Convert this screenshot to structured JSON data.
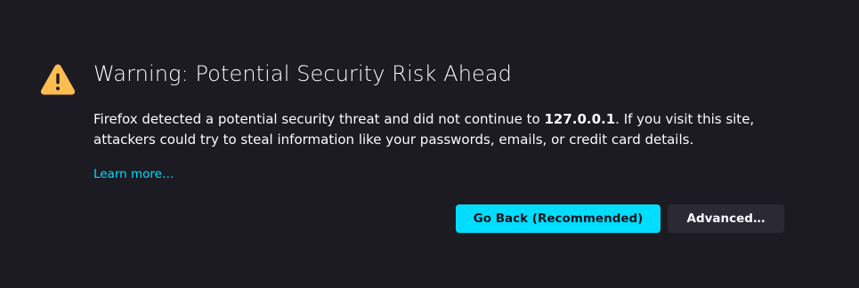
{
  "error_page": {
    "title": "Warning: Potential Security Risk Ahead",
    "desc_pre": "Firefox detected a potential security threat and did not continue to ",
    "host": "127.0.0.1",
    "desc_post": ". If you visit this site, attackers could try to steal information like your passwords, emails, or credit card details.",
    "learn_more": "Learn more…",
    "go_back_label": "Go Back (Recommended)",
    "advanced_label": "Advanced…",
    "icon": "warning-triangle-icon"
  },
  "colors": {
    "background": "#1c1b22",
    "text": "#fbfbfe",
    "accent": "#00ddff",
    "warning": "#ffbd4f",
    "secondary_button": "#2b2a33"
  }
}
